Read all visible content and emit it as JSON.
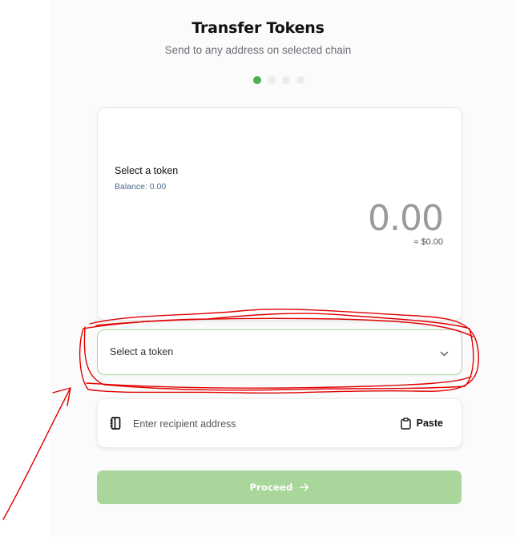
{
  "header": {
    "title": "Transfer Tokens",
    "subtitle": "Send to any address on selected chain"
  },
  "steps": {
    "total": 4,
    "current": 1
  },
  "amount_card": {
    "token_label": "Select a token",
    "balance": "Balance: 0.00",
    "amount": "0.00",
    "usd_value": "≈ $0.00"
  },
  "token_select": {
    "label": "Select a token"
  },
  "recipient": {
    "placeholder": "Enter recipient address",
    "paste_label": "Paste"
  },
  "proceed": {
    "label": "Proceed"
  },
  "colors": {
    "accent": "#4caf50",
    "proceed_bg": "#a9d79b",
    "select_border": "#a9d79b",
    "annotation": "#e10000"
  },
  "icons": [
    "chevron-down-icon",
    "address-book-icon",
    "clipboard-icon",
    "arrow-right-icon"
  ]
}
